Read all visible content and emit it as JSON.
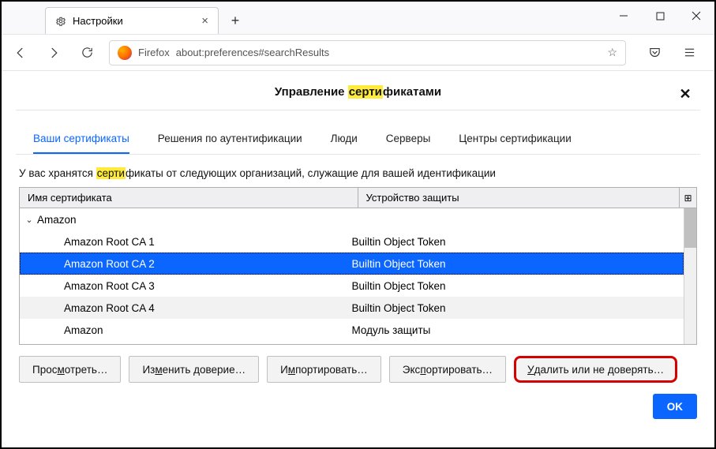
{
  "window": {
    "tab_title": "Настройки",
    "url_brand": "Firefox",
    "url_text": "about:preferences#searchResults"
  },
  "modal": {
    "title_pre": "Управление ",
    "title_hl": "серти",
    "title_post": "фикатами"
  },
  "tabs": {
    "your_certs": "Ваши сертификаты",
    "auth": "Решения по аутентификации",
    "people": "Люди",
    "servers": "Серверы",
    "ca": "Центры сертификации"
  },
  "desc_pre": "У вас хранятся ",
  "desc_hl": "серти",
  "desc_post": "фикаты от следующих организаций, служащие для вашей идентификации",
  "columns": {
    "name": "Имя сертификата",
    "device": "Устройство защиты"
  },
  "group": "Amazon",
  "rows": [
    {
      "name": "Amazon Root CA 1",
      "device": "Builtin Object Token",
      "alt": false,
      "selected": false
    },
    {
      "name": "Amazon Root CA 2",
      "device": "Builtin Object Token",
      "alt": true,
      "selected": true
    },
    {
      "name": "Amazon Root CA 3",
      "device": "Builtin Object Token",
      "alt": false,
      "selected": false
    },
    {
      "name": "Amazon Root CA 4",
      "device": "Builtin Object Token",
      "alt": true,
      "selected": false
    },
    {
      "name": "Amazon",
      "device": "Модуль защиты",
      "alt": false,
      "selected": false
    }
  ],
  "actions": {
    "view": {
      "pre": "Прос",
      "key": "м",
      "post": "отреть…"
    },
    "edit": {
      "pre": "Из",
      "key": "м",
      "post": "енить доверие…"
    },
    "import": {
      "pre": "И",
      "key": "м",
      "post": "портировать…"
    },
    "export": {
      "pre": "Экс",
      "key": "п",
      "post": "ортировать…"
    },
    "delete": {
      "pre": "",
      "key": "У",
      "post": "далить или не доверять…"
    },
    "ok": "OK"
  }
}
